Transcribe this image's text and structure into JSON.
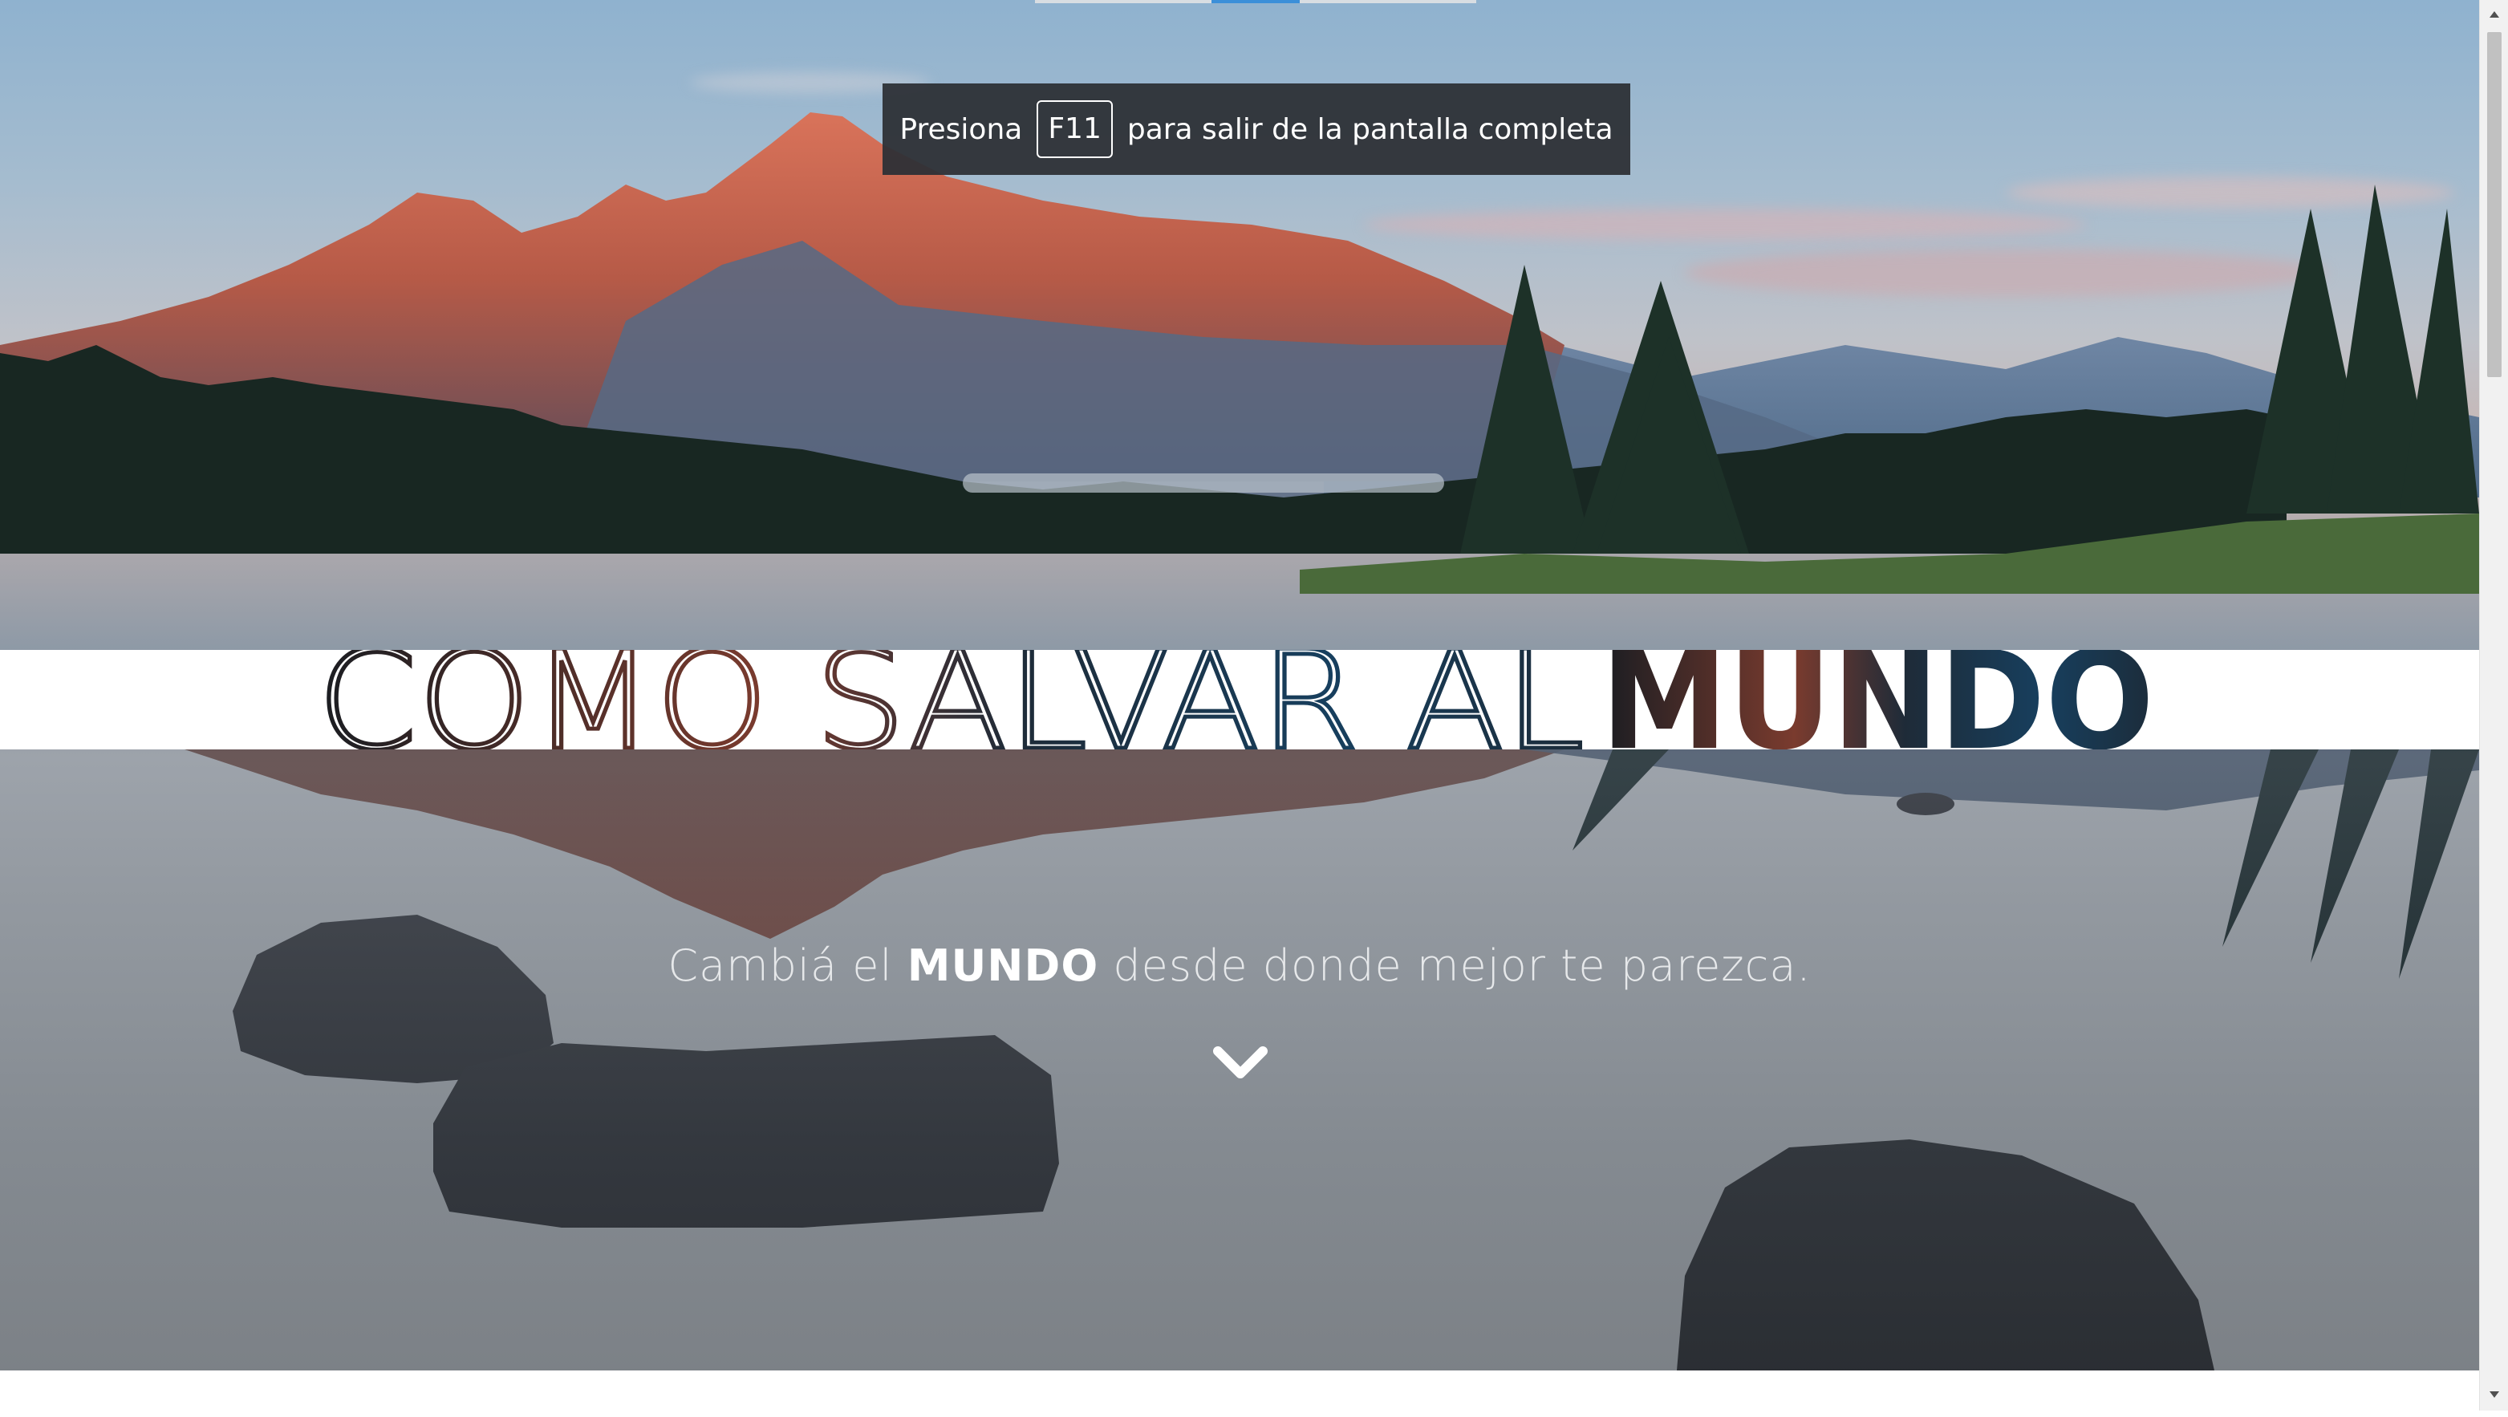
{
  "toast": {
    "prefix": "Presiona",
    "key": "F11",
    "suffix": "para salir de la pantalla completa"
  },
  "hero": {
    "title_light": "COMO SALVAR AL",
    "title_bold": "MUNDO",
    "subtitle_pre": "Cambiá el",
    "subtitle_bold": "MUNDO",
    "subtitle_post": "desde donde mejor te parezca."
  },
  "icons": {
    "scroll_down": "chevron-down-icon",
    "scroll_up_arrow": "triangle-up-icon",
    "scroll_down_arrow": "triangle-down-icon"
  },
  "colors": {
    "title_band": "#ffffff",
    "toast_bg": "#2d3035",
    "accent": "#3b8fd9"
  }
}
